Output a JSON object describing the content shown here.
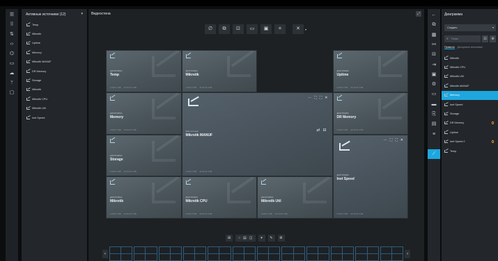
{
  "left_rail": {
    "icons": [
      "menu-icon",
      "grid-icon",
      "sort-icon",
      "code-icon",
      "layers-icon",
      "monitor-icon",
      "cloud-icon",
      "branch-icon",
      "tv-icon"
    ],
    "glyphs": [
      "☰",
      "⠿",
      "⇅",
      "‹›",
      "⌬",
      "▭",
      "☁",
      "ᛘ",
      "▢"
    ]
  },
  "sources": {
    "header": "Активные источники (12)",
    "items": [
      "Temp",
      "Mikrotik",
      "Uptime",
      "Memory",
      "Mikrotik MANUF",
      "DR Memory",
      "Storage",
      "Mikrotik",
      "Mikrotik CPU",
      "Mikrotik Util",
      "Inet Speed"
    ]
  },
  "main": {
    "title": "Видеостена",
    "expand_glyph": "⤢",
    "toolbar": [
      "∅",
      "⧉",
      "⊡",
      "▭",
      "▣",
      "⌗",
      "✕"
    ],
    "toolbar_dropdown": "▾",
    "tile_type": "ДИАГРАММА",
    "tile_type_web": "Web-источник",
    "tile_foot_a": "0.0021.0 МБ",
    "tile_foot_b": "42.09.02 0 МБ",
    "tiles": [
      {
        "name": "Temp"
      },
      {
        "name": "Mikrotik"
      },
      {
        "name": "Uptime"
      },
      {
        "name": "Memory"
      },
      {
        "name": "DR Memory"
      },
      {
        "name": "Storage"
      },
      {
        "name": "Mikrotik MANUF"
      },
      {
        "name": "Inet Speed"
      },
      {
        "name": "Mikrotik"
      },
      {
        "name": "Mikrotik CPU"
      },
      {
        "name": "Mikrotik Util"
      }
    ],
    "tile_controls": [
      "⋯",
      "⛶",
      "⛶",
      "✕"
    ],
    "swap_glyphs": [
      "⇄",
      "⊟"
    ],
    "pager": {
      "grid_glyph": "⊞",
      "zoom": [
        "○",
        "▤",
        "◫"
      ],
      "dropdown": "▾",
      "edit_glyph": "✎",
      "settings_glyph": "⚙"
    },
    "strip_prev": "‹",
    "strip_next": "›"
  },
  "right_rail": {
    "icons": [
      "back-arrow-icon",
      "dashboard-icon",
      "table-icon",
      "share-icon",
      "window-icon",
      "login-icon",
      "image-icon",
      "gear-icon",
      "display-icon",
      "card-icon",
      "doc-icon",
      "screen-icon",
      "list-icon",
      "chart-icon"
    ],
    "glyphs": [
      "←",
      "⧉",
      "▦",
      "⚯",
      "⊟",
      "⇥",
      "▣",
      "⚙",
      "▭",
      "▬",
      "⎘",
      "▤",
      "≡",
      "⟋"
    ]
  },
  "diagram": {
    "header": "Диаграмма",
    "select": "Создать",
    "search_placeholder": "Поиск",
    "search_icon": "⌕",
    "btn_a": "⊡",
    "btn_b": "⊛",
    "tab_active": "Правила",
    "tab_other": "Доступные источники",
    "items": [
      {
        "label": "Mikrotik",
        "active": false,
        "warn": false
      },
      {
        "label": "Mikrotik CPU",
        "active": false,
        "warn": false
      },
      {
        "label": "Mikrotik Util",
        "active": false,
        "warn": false
      },
      {
        "label": "Mikrotik MANUF",
        "active": false,
        "warn": false
      },
      {
        "label": "Memory",
        "active": true,
        "warn": false
      },
      {
        "label": "Inet Speed",
        "active": false,
        "warn": false
      },
      {
        "label": "Storage",
        "active": false,
        "warn": false
      },
      {
        "label": "DR Memory",
        "active": false,
        "warn": true
      },
      {
        "label": "Uptime",
        "active": false,
        "warn": false
      },
      {
        "label": "Inet Speed 2",
        "active": false,
        "warn": true
      },
      {
        "label": "Temp",
        "active": false,
        "warn": false
      }
    ]
  }
}
